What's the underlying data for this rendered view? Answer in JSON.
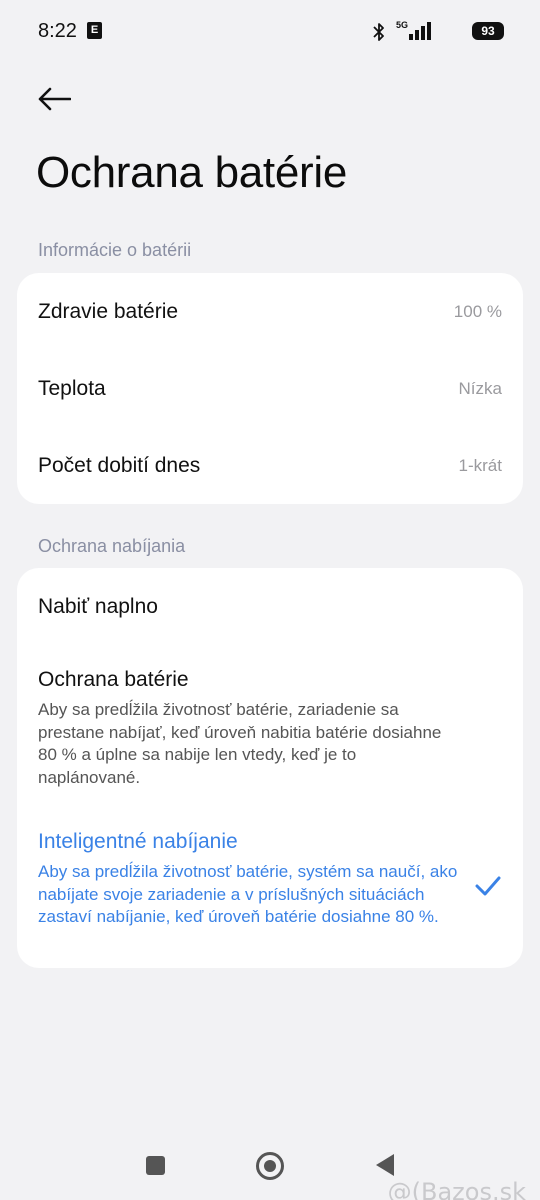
{
  "status_bar": {
    "time": "8:22",
    "notification_glyph": "E",
    "network": "5G",
    "battery": "93",
    "icons": [
      "bluetooth-icon",
      "signal-icon",
      "battery-icon"
    ]
  },
  "header": {
    "back_icon": "arrow-left-icon",
    "title": "Ochrana batérie"
  },
  "battery_info": {
    "section_title": "Informácie o batérii",
    "rows": [
      {
        "label": "Zdravie batérie",
        "value": "100 %"
      },
      {
        "label": "Teplota",
        "value": "Nízka"
      },
      {
        "label": "Počet dobití dnes",
        "value": "1-krát"
      }
    ]
  },
  "charging_protection": {
    "section_title": "Ochrana nabíjania",
    "options": [
      {
        "title": "Nabiť naplno",
        "description": "",
        "selected": false
      },
      {
        "title": "Ochrana batérie",
        "description": "Aby sa predĺžila životnosť batérie, zariadenie sa prestane nabíjať, keď úroveň nabitia batérie dosiahne 80 % a úplne sa nabije len vtedy, keď je to naplánované.",
        "selected": false
      },
      {
        "title": "Inteligentné nabíjanie",
        "description": "Aby sa predĺžila životnosť batérie, systém sa naučí, ako nabíjate svoje zariadenie a v príslušných situáciách zastaví nabíjanie, keď úroveň batérie dosiahne 80 %.",
        "selected": true
      }
    ]
  },
  "colors": {
    "background": "#f2f2f4",
    "card": "#ffffff",
    "accent": "#3a82e6",
    "section_header": "#8a8fa3"
  },
  "watermark": "@(Bazos.sk"
}
